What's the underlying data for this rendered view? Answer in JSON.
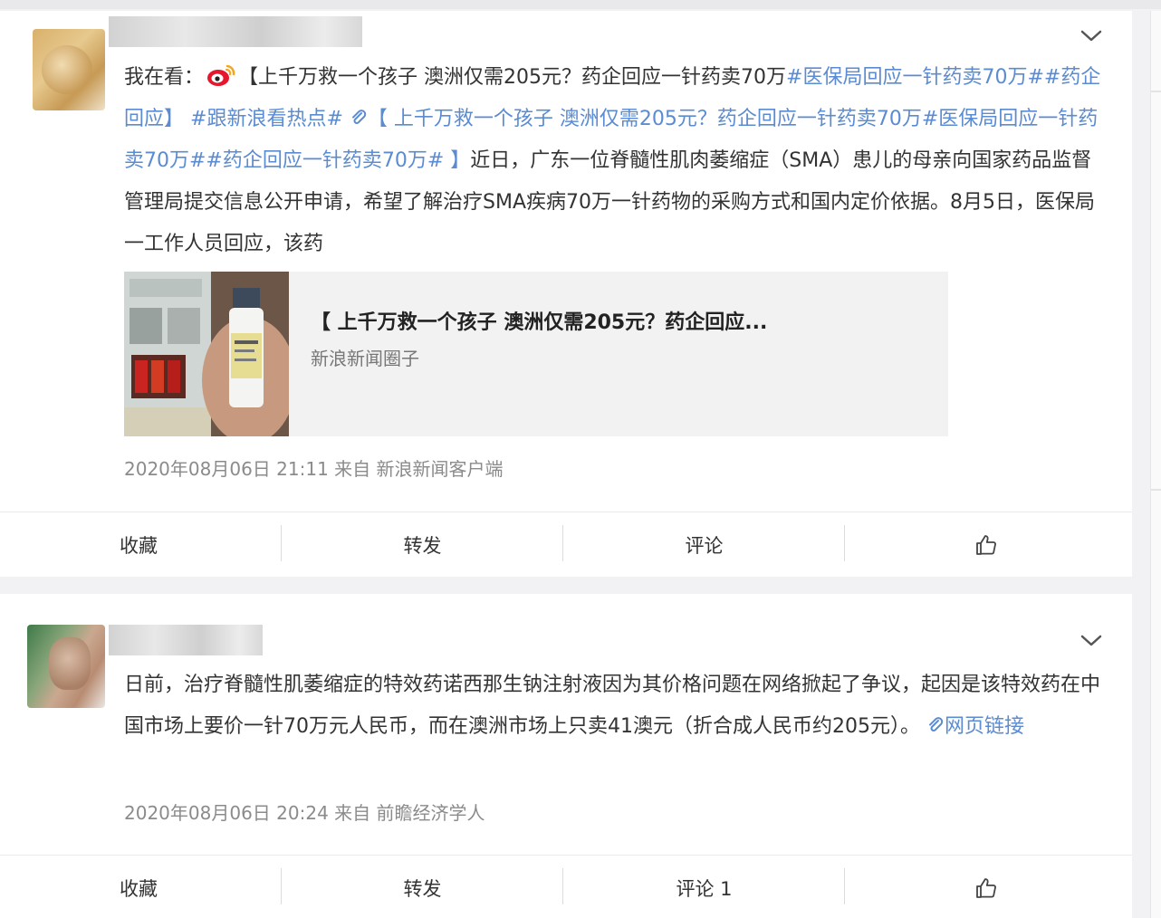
{
  "posts": [
    {
      "body": {
        "prefix": "我在看：",
        "pre_logo": "【",
        "title_text": "上千万救一个孩子 澳洲仅需205元？药企回应一针药卖70万",
        "tag_a": "#医保局回应一针药卖70万#",
        "tag_b": "#药企回应】",
        "tag_c": " #跟新浪看热点#",
        "link_text": "【 上千万救一个孩子 澳洲仅需205元？药企回应一针药卖70万#医保局回应一针药卖70万##药企回应一针药卖70万#",
        "link_close": " 】",
        "rest": "近日，广东一位脊髓性肌肉萎缩症（SMA）患儿的母亲向国家药品监督管理局提交信息公开申请，希望了解治疗SMA疾病70万一针药物的采购方式和国内定价依据。8月5日，医保局一工作人员回应，该药"
      },
      "media": {
        "title": "【 上千万救一个孩子 澳洲仅需205元？药企回应...",
        "source": "新浪新闻圈子"
      },
      "meta": "2020年08月06日 21:11  来自 新浪新闻客户端",
      "actions": {
        "favorite": "收藏",
        "repost": "转发",
        "comment": "评论",
        "like_icon": "thumbs-up-icon"
      }
    },
    {
      "body": {
        "text": "日前，治疗脊髓性肌萎缩症的特效药诺西那生钠注射液因为其价格问题在网络掀起了争议，起因是该特效药在中国市场上要价一针70万元人民币，而在澳洲市场上只卖41澳元（折合成人民币约205元）。",
        "link_text": "网页链接"
      },
      "meta": "2020年08月06日 20:24  来自 前瞻经济学人",
      "actions": {
        "favorite": "收藏",
        "repost": "转发",
        "comment": "评论 1",
        "like_icon": "thumbs-up-icon"
      }
    }
  ],
  "colors": {
    "link": "#5b8bd0",
    "meta": "#8b8b8b",
    "weibo_red": "#e6162d",
    "weibo_orange": "#f4a623"
  }
}
